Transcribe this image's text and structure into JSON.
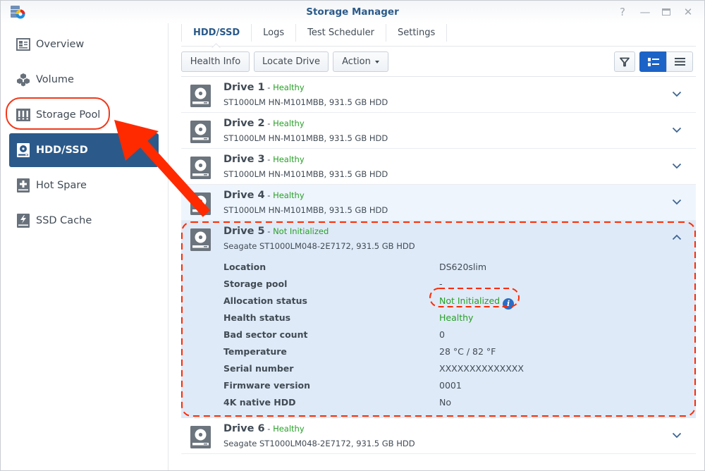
{
  "window": {
    "title": "Storage Manager",
    "controls": [
      {
        "name": "help",
        "glyph": "?"
      },
      {
        "name": "minimize",
        "glyph": "—"
      },
      {
        "name": "maximize",
        "glyph": "▭"
      },
      {
        "name": "close",
        "glyph": "✕"
      }
    ]
  },
  "sidebar": {
    "items": [
      {
        "label": "Overview",
        "icon": "overview-icon",
        "active": false
      },
      {
        "label": "Volume",
        "icon": "volume-icon",
        "active": false
      },
      {
        "label": "Storage Pool",
        "icon": "storage-pool-icon",
        "active": false,
        "highlighted": true
      },
      {
        "label": "HDD/SSD",
        "icon": "hdd-icon",
        "active": true
      },
      {
        "label": "Hot Spare",
        "icon": "hot-spare-icon",
        "active": false
      },
      {
        "label": "SSD Cache",
        "icon": "ssd-cache-icon",
        "active": false
      }
    ]
  },
  "tabs": [
    {
      "label": "HDD/SSD",
      "active": true
    },
    {
      "label": "Logs",
      "active": false
    },
    {
      "label": "Test Scheduler",
      "active": false
    },
    {
      "label": "Settings",
      "active": false
    }
  ],
  "toolbar": {
    "health_info": "Health Info",
    "locate_drive": "Locate Drive",
    "action": "Action",
    "filter_icon": "filter-icon",
    "view_list_detail_icon": "list-detail-icon",
    "view_list_icon": "list-icon",
    "active_view": "list-detail"
  },
  "drives": [
    {
      "name": "Drive 1",
      "sep": " - ",
      "status": "Healthy",
      "model": "ST1000LM HN-M101MBB, 931.5 GB HDD",
      "expanded": false
    },
    {
      "name": "Drive 2",
      "sep": " - ",
      "status": "Healthy",
      "model": "ST1000LM HN-M101MBB, 931.5 GB HDD",
      "expanded": false
    },
    {
      "name": "Drive 3",
      "sep": " - ",
      "status": "Healthy",
      "model": "ST1000LM HN-M101MBB, 931.5 GB HDD",
      "expanded": false
    },
    {
      "name": "Drive 4",
      "sep": " - ",
      "status": "Healthy",
      "model": "ST1000LM HN-M101MBB, 931.5 GB HDD",
      "expanded": false
    },
    {
      "name": "Drive 5",
      "sep": " - ",
      "status": "Not Initialized",
      "model": "Seagate ST1000LM048-2E7172, 931.5 GB HDD",
      "expanded": true
    },
    {
      "name": "Drive 6",
      "sep": " - ",
      "status": "Healthy",
      "model": "Seagate ST1000LM048-2E7172, 931.5 GB HDD",
      "expanded": false
    }
  ],
  "drive5_details": [
    {
      "key": "Location",
      "value": "DS620slim"
    },
    {
      "key": "Storage pool",
      "value": "-"
    },
    {
      "key": "Allocation status",
      "value": "Not Initialized",
      "info": true
    },
    {
      "key": "Health status",
      "value": "Healthy"
    },
    {
      "key": "Bad sector count",
      "value": "0"
    },
    {
      "key": "Temperature",
      "value": "28 °C / 82 °F"
    },
    {
      "key": "Serial number",
      "value": "XXXXXXXXXXXXXX"
    },
    {
      "key": "Firmware version",
      "value": "0001"
    },
    {
      "key": "4K native HDD",
      "value": "No"
    }
  ],
  "colors": {
    "accent": "#2b5a8a",
    "healthy": "#28a028",
    "annotation": "#ff2a00",
    "expanded_bg": "#dfeaf8",
    "view_active": "#1c63c7"
  },
  "annotations": {
    "arrow": "red arrow pointing from Drive 4 to Storage Pool",
    "highlights": [
      "Storage Pool sidebar item",
      "Drive 5 panel",
      "Allocation status value"
    ]
  }
}
